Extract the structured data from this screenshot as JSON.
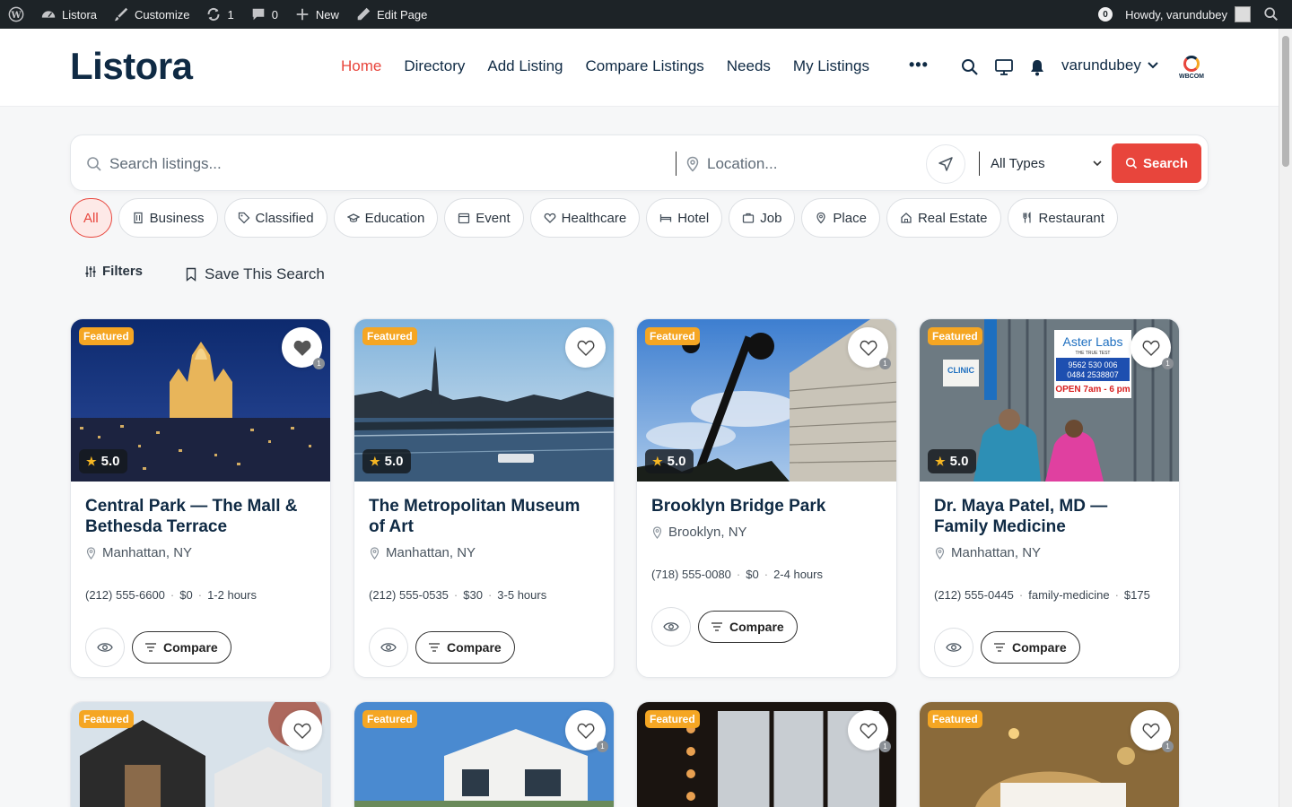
{
  "adminbar": {
    "site": "Listora",
    "customize": "Customize",
    "updates": "1",
    "comments": "0",
    "new": "New",
    "edit": "Edit Page",
    "notif_count": "0",
    "howdy": "Howdy, varundubey"
  },
  "header": {
    "logo": "Listora",
    "nav": [
      "Home",
      "Directory",
      "Add Listing",
      "Compare Listings",
      "Needs",
      "My Listings"
    ],
    "more": "•••",
    "username": "varundubey",
    "brand_text": "WBCOM"
  },
  "search": {
    "keyword_placeholder": "Search listings...",
    "location_placeholder": "Location...",
    "type_value": "All Types",
    "button": "Search"
  },
  "categories": [
    {
      "label": "All",
      "icon": "none"
    },
    {
      "label": "Business",
      "icon": "building-icon"
    },
    {
      "label": "Classified",
      "icon": "tag-icon"
    },
    {
      "label": "Education",
      "icon": "graduation-cap-icon"
    },
    {
      "label": "Event",
      "icon": "calendar-icon"
    },
    {
      "label": "Healthcare",
      "icon": "heart-pulse-icon"
    },
    {
      "label": "Hotel",
      "icon": "bed-icon"
    },
    {
      "label": "Job",
      "icon": "briefcase-icon"
    },
    {
      "label": "Place",
      "icon": "map-pin-icon"
    },
    {
      "label": "Real Estate",
      "icon": "home-icon"
    },
    {
      "label": "Restaurant",
      "icon": "utensils-icon"
    }
  ],
  "toolbar": {
    "filters": "Filters",
    "save_search": "Save This Search"
  },
  "cards": [
    {
      "featured": "Featured",
      "rating": "5.0",
      "fav_count": "1",
      "favorited": true,
      "title": "Central Park — The Mall & Bethesda Terrace",
      "location": "Manhattan, NY",
      "meta": [
        "(212) 555-6600",
        "$0",
        "1-2 hours"
      ],
      "compare": "Compare"
    },
    {
      "featured": "Featured",
      "rating": "5.0",
      "fav_count": "",
      "favorited": false,
      "title": "The Metropolitan Museum of Art",
      "location": "Manhattan, NY",
      "meta": [
        "(212) 555-0535",
        "$30",
        "3-5 hours"
      ],
      "compare": "Compare"
    },
    {
      "featured": "Featured",
      "rating": "5.0",
      "fav_count": "1",
      "favorited": false,
      "title": "Brooklyn Bridge Park",
      "location": "Brooklyn, NY",
      "meta": [
        "(718) 555-0080",
        "$0",
        "2-4 hours"
      ],
      "compare": "Compare"
    },
    {
      "featured": "Featured",
      "rating": "5.0",
      "fav_count": "1",
      "favorited": false,
      "title": "Dr. Maya Patel, MD — Family Medicine",
      "location": "Manhattan, NY",
      "meta": [
        "(212) 555-0445",
        "family-medicine",
        "$175"
      ],
      "compare": "Compare",
      "image_text": [
        "CLINIC",
        "Aster Labs",
        "THE TRUE TEST",
        "9562 530 006",
        "0484 2538807",
        "OPEN 7am - 6 pm"
      ]
    },
    {
      "featured": "Featured",
      "fav_count": "",
      "favorited": false
    },
    {
      "featured": "Featured",
      "fav_count": "1",
      "favorited": false
    },
    {
      "featured": "Featured",
      "fav_count": "1",
      "favorited": false
    },
    {
      "featured": "Featured",
      "fav_count": "1",
      "favorited": false
    }
  ],
  "colors": {
    "accent": "#e8453c",
    "navy": "#0f2a44",
    "featured": "#f5a623"
  }
}
